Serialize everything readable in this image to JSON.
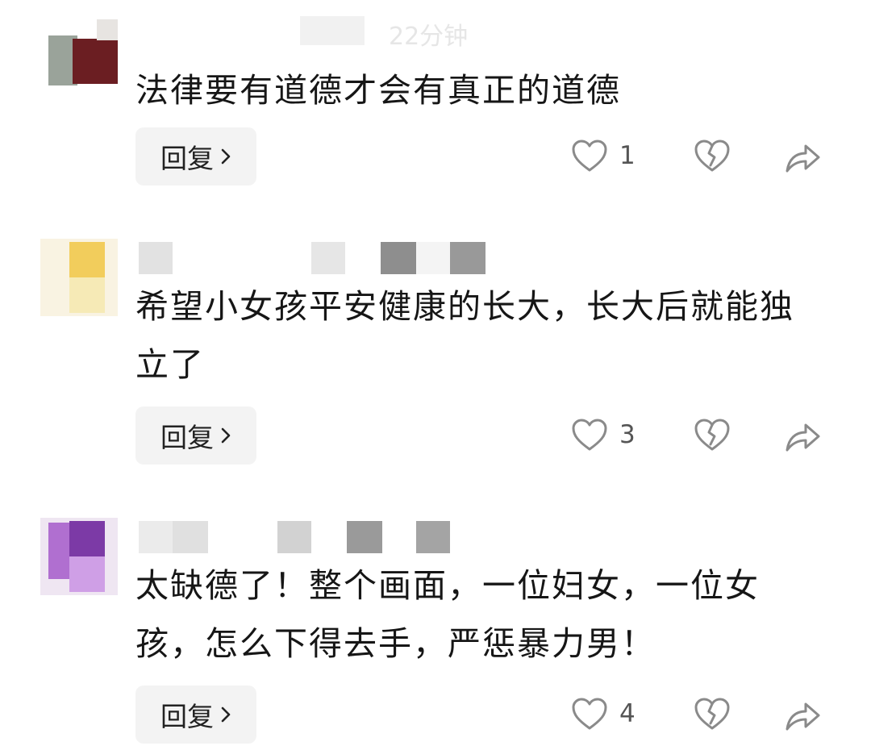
{
  "comments": [
    {
      "meta_text": "22分钟",
      "text": "法律要有道德才会有真正的道德",
      "reply_label": "回复",
      "like_count": "1"
    },
    {
      "meta_text": "",
      "text": "希望小女孩平安健康的长大，长大后就能独立了",
      "reply_label": "回复",
      "like_count": "3"
    },
    {
      "meta_text": "",
      "text": "太缺德了！整个画面，一位妇女，一位女孩，怎么下得去手，严惩暴力男！",
      "reply_label": "回复",
      "like_count": "4"
    }
  ],
  "icons": {
    "like": "heart-outline-icon",
    "dislike": "broken-heart-icon",
    "share": "share-arrow-icon",
    "reply_chevron": "chevron-right-icon"
  },
  "colors": {
    "reply_bg": "#f3f3f3",
    "icon": "#8a8a8a",
    "text": "#161616"
  }
}
